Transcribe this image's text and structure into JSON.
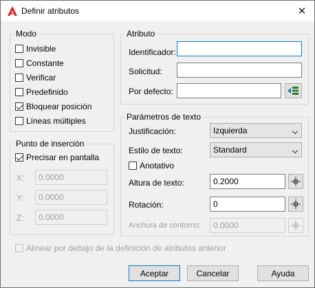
{
  "window": {
    "title": "Definir atributos",
    "close_glyph": "✕"
  },
  "mode": {
    "legend": "Modo",
    "options": [
      {
        "label": "Invisible",
        "checked": false
      },
      {
        "label": "Constante",
        "checked": false
      },
      {
        "label": "Verificar",
        "checked": false
      },
      {
        "label": "Predefinido",
        "checked": false
      },
      {
        "label": "Bloquear posición",
        "checked": true
      },
      {
        "label": "Líneas múltiples",
        "checked": false
      }
    ]
  },
  "insertion": {
    "legend": "Punto de inserción",
    "on_screen_label": "Precisar en pantalla",
    "on_screen_checked": true,
    "x_label": "X:",
    "x_value": "0.0000",
    "y_label": "Y:",
    "y_value": "0.0000",
    "z_label": "Z:",
    "z_value": "0.0000"
  },
  "attribute": {
    "legend": "Atributo",
    "tag_label": "Identificador:",
    "tag_value": "",
    "prompt_label": "Solicitud:",
    "prompt_value": "",
    "default_label": "Por defecto:",
    "default_value": ""
  },
  "text": {
    "legend": "Parámetros de texto",
    "justification_label": "Justificación:",
    "justification_value": "Izquierda",
    "style_label": "Estilo de texto:",
    "style_value": "Standard",
    "annotative_label": "Anotativo",
    "annotative_checked": false,
    "height_label": "Altura de texto:",
    "height_value": "0.2000",
    "rotation_label": "Rotación:",
    "rotation_value": "0",
    "width_label": "Anchura de contorno:",
    "width_value": "0.0000"
  },
  "align_below": {
    "label": "Alinear por debajo de la definición de atributos anterior",
    "checked": false
  },
  "buttons": {
    "ok": "Aceptar",
    "cancel": "Cancelar",
    "help": "Ayuda"
  },
  "colors": {
    "accent": "#0078d7",
    "autocad_red": "#d9241c"
  },
  "icons": [
    "autocad-logo-icon",
    "close-icon",
    "insert-field-icon",
    "pick-point-icon",
    "chevron-down-icon"
  ]
}
